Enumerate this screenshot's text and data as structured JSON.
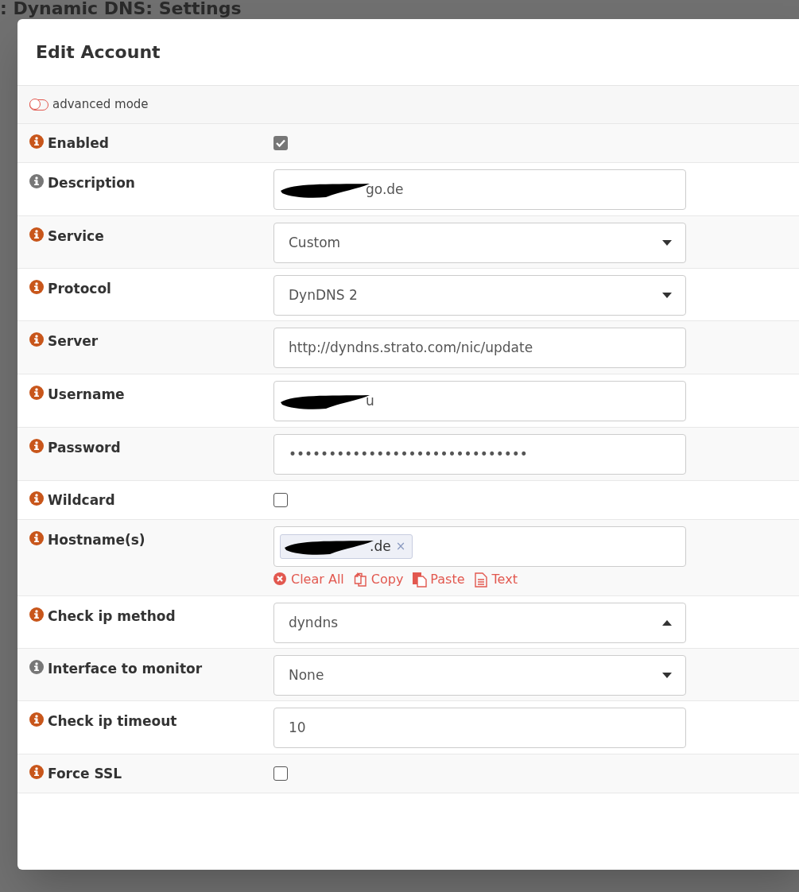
{
  "page_title": ": Dynamic DNS: Settings",
  "dialog": {
    "title": "Edit Account",
    "advanced_mode": {
      "label": "advanced mode",
      "on": false
    },
    "fields": [
      {
        "kind": "checkbox",
        "label": "Enabled",
        "color": "#c8561b",
        "checked": true
      },
      {
        "kind": "text",
        "label": "Description",
        "color": "#777777",
        "value": "go.de",
        "redacted": true
      },
      {
        "kind": "select",
        "label": "Service",
        "color": "#c8561b",
        "value": "Custom",
        "expanded": false
      },
      {
        "kind": "select",
        "label": "Protocol",
        "color": "#c8561b",
        "value": "DynDNS 2",
        "expanded": false
      },
      {
        "kind": "text",
        "label": "Server",
        "color": "#c8561b",
        "value": "http://dyndns.strato.com/nic/update",
        "redacted": false
      },
      {
        "kind": "text",
        "label": "Username",
        "color": "#c8561b",
        "value": "u",
        "redacted": true
      },
      {
        "kind": "text",
        "label": "Password",
        "color": "#c8561b",
        "value": "••••••••••••••••••••••••••••••",
        "redacted": false
      },
      {
        "kind": "checkbox",
        "label": "Wildcard",
        "color": "#c8561b",
        "checked": false
      },
      {
        "kind": "tags",
        "label": "Hostname(s)",
        "color": "#c8561b",
        "tags": [
          {
            "text": ".de",
            "remove": "×"
          }
        ],
        "actions": [
          "Clear All",
          "Copy",
          "Paste",
          "Text"
        ]
      },
      {
        "kind": "select",
        "label": "Check ip method",
        "color": "#c8561b",
        "value": "dyndns",
        "expanded": true
      },
      {
        "kind": "select",
        "label": "Interface to monitor",
        "color": "#777777",
        "value": "None",
        "expanded": false
      },
      {
        "kind": "text",
        "label": "Check ip timeout",
        "color": "#c8561b",
        "value": "10",
        "redacted": false
      },
      {
        "kind": "checkbox",
        "label": "Force SSL",
        "color": "#c8561b",
        "checked": false
      }
    ]
  }
}
